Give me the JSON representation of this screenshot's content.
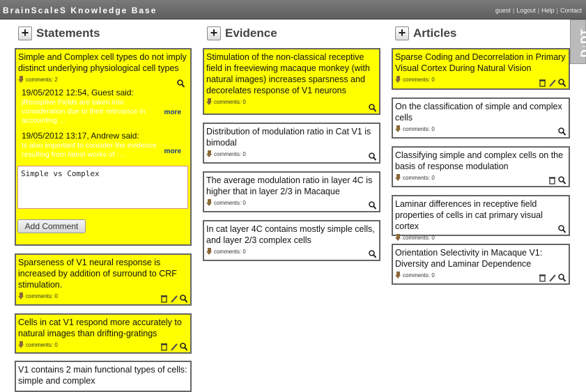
{
  "app": {
    "brand": "BrainScaleS Knowledge Base",
    "links": [
      "guest",
      "Logout",
      "Help",
      "Contact"
    ]
  },
  "badge": "D↓DT",
  "columns": {
    "statements": {
      "title": "Statements",
      "cards": [
        {
          "text": "Simple and Complex cell types do not imply distinct underlying physiological cell types",
          "comments": "comments: 2"
        },
        {
          "text": "Sparseness of V1 neural response is increased by addition of surround to CRF stimulation.",
          "comments": "comments: 0"
        },
        {
          "text": "Cells in cat V1 respond more accurately to natural images than drifting-gratings",
          "comments": "comments: 0"
        },
        {
          "text": "V1 contains 2 main functional types of cells: simple and complex"
        }
      ],
      "thread": [
        {
          "header": "19/05/2012 12:54, Guest said:",
          "body": "jReceptive Fields are taken into consideration due to their relevance in accounting …",
          "more": "more"
        },
        {
          "header": "19/05/2012 13:17, Andrew said:",
          "body": "Is also important to consider the evidence resulting from latest works of ….",
          "more": "more"
        }
      ],
      "comment_input": "Simple vs Complex",
      "add_comment": "Add Comment"
    },
    "evidence": {
      "title": "Evidence",
      "cards": [
        {
          "text": "Stimulation of the non-classical receptive field in freeviewing macaque monkey (with natural images) increases sparsness and decorelates response of V1 neurons",
          "comments": "comments: 0"
        },
        {
          "text": "Distribution of modulation ratio in Cat V1 is bimodal",
          "comments": "comments: 0"
        },
        {
          "text": "The average modulation ratio in layer 4C is higher that in layer 2/3 in Macaque",
          "comments": "comments: 0"
        },
        {
          "text": "In cat layer 4C contains mostly simple cells, and layer 2/3 complex cells",
          "comments": "comments: 0"
        }
      ]
    },
    "articles": {
      "title": "Articles",
      "cards": [
        {
          "text": "Sparse Coding and Decorrelation in Primary Visual Cortex During Natural Vision",
          "comments": "comments: 0"
        },
        {
          "text": "On the classification of simple and complex cells",
          "comments": "comments: 0"
        },
        {
          "text": "Classifying simple and complex cells on the basis of response modulation",
          "comments": "comments: 0"
        },
        {
          "text": "Laminar differences in receptive field properties of cells in cat primary visual cortex",
          "comments": "comments: 0"
        },
        {
          "text": "Orientation Selectivity in Macaque V1: Diversity and Laminar Dependence",
          "comments": "comments: 0"
        }
      ]
    }
  },
  "colors": {
    "highlight": "#ffff00",
    "topbar": "#6a6a6a",
    "link": "#1a3a8a"
  }
}
